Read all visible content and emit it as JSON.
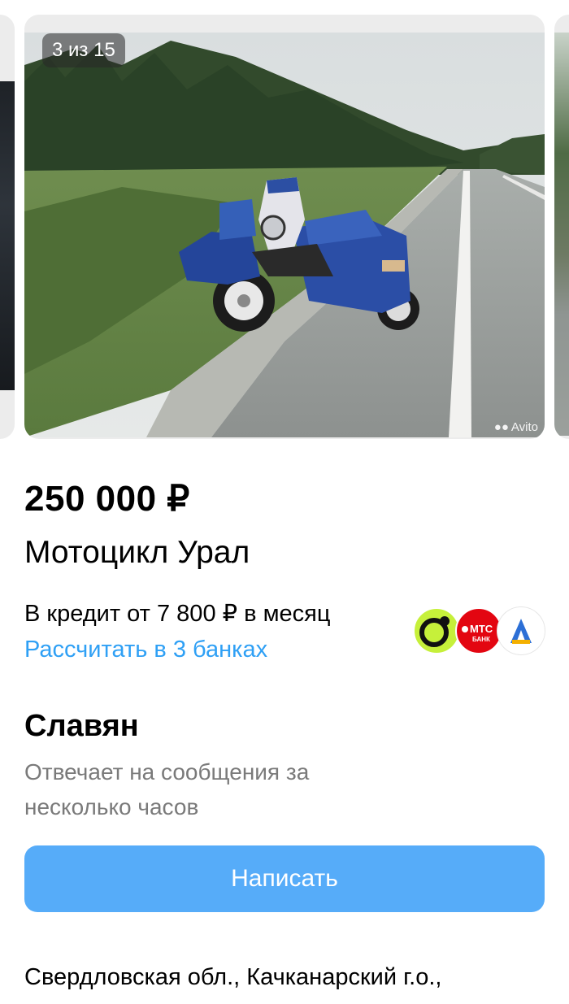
{
  "gallery": {
    "counter": "3 из 15",
    "watermark": "Avito",
    "current_index": 3,
    "total": 15
  },
  "listing": {
    "price": "250 000 ₽",
    "title": "Мотоцикл Урал"
  },
  "credit": {
    "text": "В кредит от 7 800 ₽ в месяц",
    "link": "Рассчитать в 3 банках",
    "banks": [
      {
        "name": "bank-lime",
        "color": "#c6f03a"
      },
      {
        "name": "mts-bank",
        "color": "#e30611",
        "label_top": "МТС",
        "label_bottom": "БАНК"
      },
      {
        "name": "alfa-bank",
        "color": "#ffffff"
      }
    ]
  },
  "seller": {
    "name": "Славян",
    "reply_time": "Отвечает на сообщения за несколько часов"
  },
  "actions": {
    "write_label": "Написать"
  },
  "location": {
    "text": "Свердловская обл., Качканарский г.о.,"
  },
  "colors": {
    "accent": "#56acf9",
    "link": "#2fa0f5",
    "muted": "#7a7a7a"
  }
}
